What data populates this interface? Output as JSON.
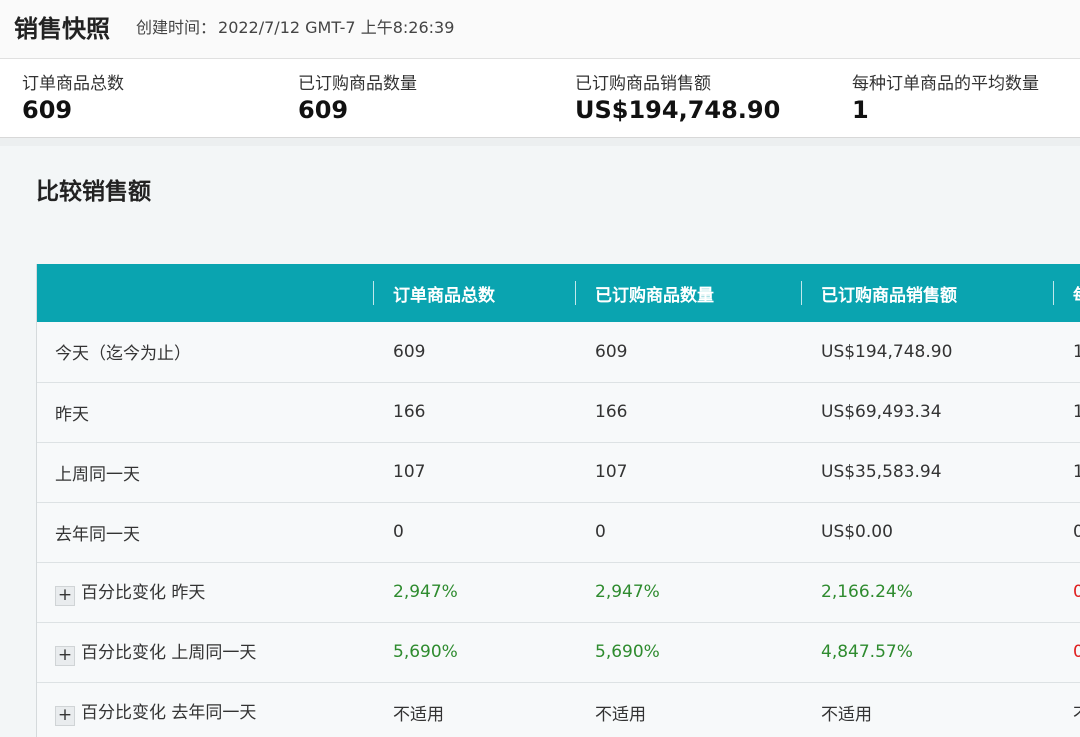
{
  "header": {
    "title": "销售快照",
    "created_label": "创建时间：",
    "created_value": "2022/7/12 GMT-7 上午8:26:39"
  },
  "metrics": [
    {
      "label": "订单商品总数",
      "value": "609"
    },
    {
      "label": "已订购商品数量",
      "value": "609"
    },
    {
      "label": "已订购商品销售额",
      "value": "US$194,748.90"
    },
    {
      "label": "每种订单商品的平均数量",
      "value": "1"
    }
  ],
  "section": {
    "title": "比较销售额"
  },
  "table": {
    "columns": [
      "",
      "订单商品总数",
      "已订购商品数量",
      "已订购商品销售额",
      "每"
    ],
    "rows": [
      {
        "label": "今天（迄今为止）",
        "expandable": false,
        "cells": [
          "609",
          "609",
          "US$194,748.90",
          "1"
        ],
        "tone": ""
      },
      {
        "label": "昨天",
        "expandable": false,
        "cells": [
          "166",
          "166",
          "US$69,493.34",
          "1"
        ],
        "tone": ""
      },
      {
        "label": "上周同一天",
        "expandable": false,
        "cells": [
          "107",
          "107",
          "US$35,583.94",
          "1"
        ],
        "tone": ""
      },
      {
        "label": "去年同一天",
        "expandable": false,
        "cells": [
          "0",
          "0",
          "US$0.00",
          "0"
        ],
        "tone": ""
      },
      {
        "label": "百分比变化 昨天",
        "expandable": true,
        "cells": [
          "2,947%",
          "2,947%",
          "2,166.24%",
          "0"
        ],
        "tone": "green",
        "last_tone": "red"
      },
      {
        "label": "百分比变化 上周同一天",
        "expandable": true,
        "cells": [
          "5,690%",
          "5,690%",
          "4,847.57%",
          "0"
        ],
        "tone": "green",
        "last_tone": "red"
      },
      {
        "label": "百分比变化 去年同一天",
        "expandable": true,
        "cells": [
          "不适用",
          "不适用",
          "不适用",
          "不"
        ],
        "tone": "",
        "last_tone": ""
      }
    ]
  },
  "icons": {
    "expand": "plus-icon"
  },
  "colors": {
    "header_bg": "#0aa4b0",
    "positive": "#2e8b2e",
    "negative": "#e02020"
  }
}
